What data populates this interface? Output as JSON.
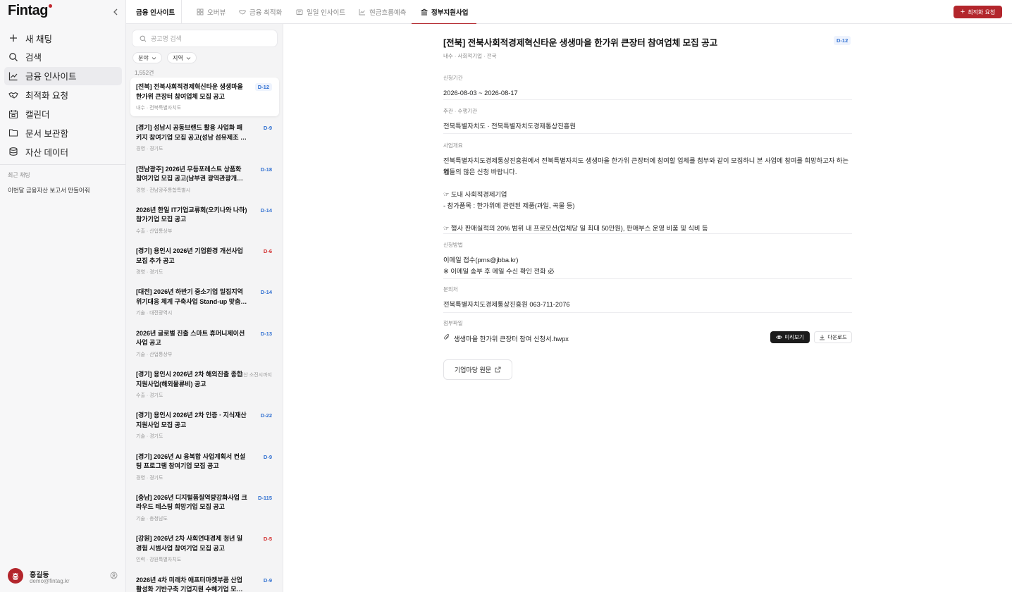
{
  "sidebar": {
    "logo": "Fintag",
    "nav": [
      {
        "label": "새 채팅",
        "icon": "plus-icon"
      },
      {
        "label": "검색",
        "icon": "search-icon"
      },
      {
        "label": "금융 인사이트",
        "icon": "chart-line-icon",
        "active": true
      },
      {
        "label": "최적화 요청",
        "icon": "handshake-icon"
      },
      {
        "label": "캘린더",
        "icon": "calendar-icon"
      },
      {
        "label": "문서 보관함",
        "icon": "folder-icon"
      },
      {
        "label": "자산 데이터",
        "icon": "database-icon"
      }
    ],
    "recent_title": "최근 채팅",
    "recent_items": [
      "이번달 금융자산 보고서 만들어줘"
    ],
    "user": {
      "initial": "홍",
      "name": "홍길동",
      "email": "demo@fintag.kr"
    }
  },
  "topbar": {
    "section": "금융 인사이트",
    "tabs": [
      {
        "label": "오버뷰",
        "icon": "grid-icon"
      },
      {
        "label": "금융 최적화",
        "icon": "handshake-icon"
      },
      {
        "label": "일일 인사이트",
        "icon": "document-icon"
      },
      {
        "label": "현금흐름예측",
        "icon": "chart-icon"
      },
      {
        "label": "정부지원사업",
        "icon": "bank-icon",
        "active": true
      }
    ],
    "request_button": "최적화 요청"
  },
  "list": {
    "search_placeholder": "공고명 검색",
    "filters": [
      "분야",
      "지역"
    ],
    "count": "1,552건",
    "items": [
      {
        "title": "[전북] 전북사회적경제혁신타운 생생마을 한가위 큰장터 참여업체 모집 공고",
        "meta": "내수 · 전북특별자치도",
        "badge": "D-12",
        "badge_type": "blue",
        "selected": true
      },
      {
        "title": "[경기] 성남시 공동브랜드 활용 사업화 패키지 참여기업 모집 공고(성남 섬유제조 소공인특...",
        "meta": "경영 · 경기도",
        "badge": "D-9",
        "badge_type": "blue"
      },
      {
        "title": "[전남광주] 2026년 무등포레스트 상품화 참여기업 모집 공고(남부권 광역관광개발 사업)",
        "meta": "경영 · 전남광주통합특별시",
        "badge": "D-18",
        "badge_type": "blue"
      },
      {
        "title": "2026년 한일 IT기업교류회(오키나와 나하) 참가기업 모집 공고",
        "meta": "수출 · 산업통상부",
        "badge": "D-14",
        "badge_type": "blue"
      },
      {
        "title": "[경기] 용인시 2026년 기업환경 개선사업 모집 추가 공고",
        "meta": "경영 · 경기도",
        "badge": "D-6",
        "badge_type": "red"
      },
      {
        "title": "[대전] 2026년 하반기 중소기업 밀집지역 위기대응 체계 구축사업 Stand-up 맞춤지원 ...",
        "meta": "기술 · 대전광역시",
        "badge": "D-14",
        "badge_type": "blue"
      },
      {
        "title": "2026년 글로벌 진출 스마트 휴머니제이션 사업 공고",
        "meta": "기술 · 산업통상부",
        "badge": "D-13",
        "badge_type": "blue"
      },
      {
        "title": "[경기] 용인시 2026년 2차 해외진출 종합지원사업(해외물류비) 공고",
        "meta": "수출 · 경기도",
        "badge": "예산 소진시까지",
        "badge_type": "gray"
      },
      {
        "title": "[경기] 용인시 2026년 2차 인증 · 지식재산 지원사업 모집 공고",
        "meta": "기술 · 경기도",
        "badge": "D-22",
        "badge_type": "blue"
      },
      {
        "title": "[경기] 2026년 AI 융복합 사업계획서 컨설팅 프로그램 참여기업 모집 공고",
        "meta": "경영 · 경기도",
        "badge": "D-9",
        "badge_type": "blue"
      },
      {
        "title": "[충남] 2026년 디지털품질역량강화사업 크라우드 테스팅 희망기업 모집 공고",
        "meta": "기술 · 충청남도",
        "badge": "D-115",
        "badge_type": "blue"
      },
      {
        "title": "[강원] 2026년 2차 사회연대경제 청년 일경험 시범사업 참여기업 모집 공고",
        "meta": "인력 · 강원특별자치도",
        "badge": "D-5",
        "badge_type": "red"
      },
      {
        "title": "2026년 4차 미래차 애프터마켓부품 산업 활성화 기반구축 기업지원 수혜기업 모집 공고",
        "meta": "",
        "badge": "D-9",
        "badge_type": "blue"
      }
    ]
  },
  "detail": {
    "title": "[전북] 전북사회적경제혁신타운 생생마을 한가위 큰장터 참여업체 모집 공고",
    "badge": "D-12",
    "tags": [
      "내수",
      "사회적기업",
      "전국"
    ],
    "period_label": "신청기간",
    "period": "2026-08-03 ~ 2026-08-17",
    "org_label": "주관 · 수행기관",
    "org": "전북특별자치도 · 전북특별자치도경제통상진흥원",
    "summary_label": "사업개요",
    "summary_lines": [
      "전북특별자치도경제통상진흥원에서 전북특별자치도 생생마을 한가위 큰장터에 참여할 업체를 첨부와 같이 모집하니 본 사업에 참여를 희망하고자 하는 업",
      "체들의 많은 신청 바랍니다.",
      "",
      "☞ 도내 사회적경제기업",
      "- 참가품목 : 한가위에 관련된 제품(과일, 곡물 등)",
      "",
      "☞ 행사 판매실적의 20% 범위 내 프로모션(업체당 일 최대 50만원), 판매부스 운영 비품 및 식비 등"
    ],
    "method_label": "신청방법",
    "method_lines": [
      "이메일 접수(pms@jbba.kr)",
      "※ 이메일 송부 후 메일 수신 확인 전화 必"
    ],
    "contact_label": "문의처",
    "contact": "전북특별자치도경제통상진흥원 063-711-2076",
    "attach_label": "첨부파일",
    "attachment": "생생마을 한가위 큰장터 참여 신청서.hwpx",
    "preview_button": "미리보기",
    "download_button": "다운로드",
    "origin_button": "기업마당 원문"
  }
}
